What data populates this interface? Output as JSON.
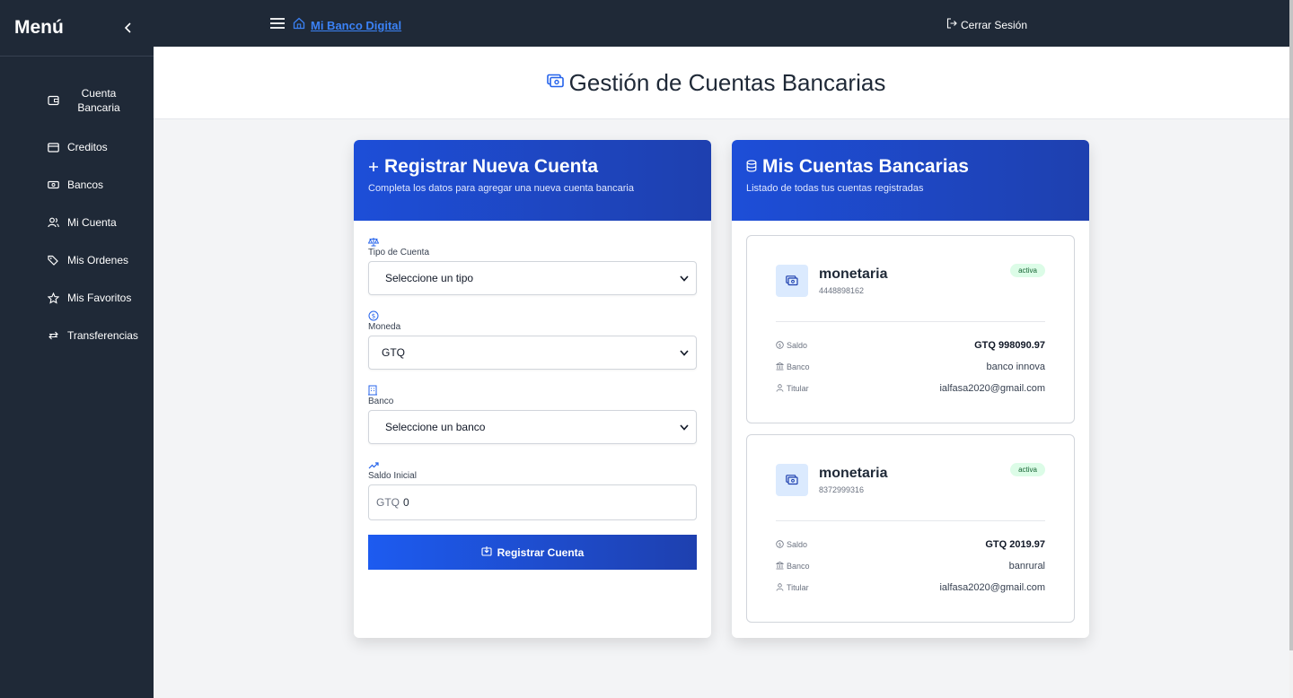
{
  "sidebar": {
    "title": "Menú",
    "items": [
      {
        "label": "Cuenta Bancaria",
        "icon": "wallet-icon"
      },
      {
        "label": "Creditos",
        "icon": "credit-card-icon"
      },
      {
        "label": "Bancos",
        "icon": "banknote-icon"
      },
      {
        "label": "Mi Cuenta",
        "icon": "users-icon"
      },
      {
        "label": "Mis Ordenes",
        "icon": "tags-icon"
      },
      {
        "label": "Mis Favoritos",
        "icon": "star-icon"
      },
      {
        "label": "Transferencias",
        "icon": "transfer-icon"
      }
    ]
  },
  "topbar": {
    "brand": "Mi Banco Digital",
    "logout": "Cerrar Sesión"
  },
  "page": {
    "title": "Gestión de Cuentas Bancarias"
  },
  "form_card": {
    "title": "Registrar Nueva Cuenta",
    "subtitle": "Completa los datos para agregar una nueva cuenta bancaria",
    "fields": {
      "tipo": {
        "label": "Tipo de Cuenta",
        "value": "Seleccione un tipo"
      },
      "moneda": {
        "label": "Moneda",
        "value": "GTQ"
      },
      "banco": {
        "label": "Banco",
        "value": "Seleccione un banco"
      },
      "saldo": {
        "label": "Saldo Inicial",
        "prefix": "GTQ",
        "value": "0"
      }
    },
    "submit": "Registrar Cuenta"
  },
  "accounts_card": {
    "title": "Mis Cuentas Bancarias",
    "subtitle": "Listado de todas tus cuentas registradas",
    "labels": {
      "saldo": "Saldo",
      "banco": "Banco",
      "titular": "Titular"
    },
    "accounts": [
      {
        "type": "monetaria",
        "number": "4448898162",
        "status": "activa",
        "saldo": "GTQ 998090.97",
        "banco": "banco innova",
        "titular": "ialfasa2020@gmail.com"
      },
      {
        "type": "monetaria",
        "number": "8372999316",
        "status": "activa",
        "saldo": "GTQ 2019.97",
        "banco": "banrural",
        "titular": "ialfasa2020@gmail.com"
      }
    ]
  },
  "colors": {
    "sidebar": "#1f2937",
    "accent": "#1d4ed8",
    "badge_bg": "#dcfce7",
    "badge_text": "#166534"
  }
}
